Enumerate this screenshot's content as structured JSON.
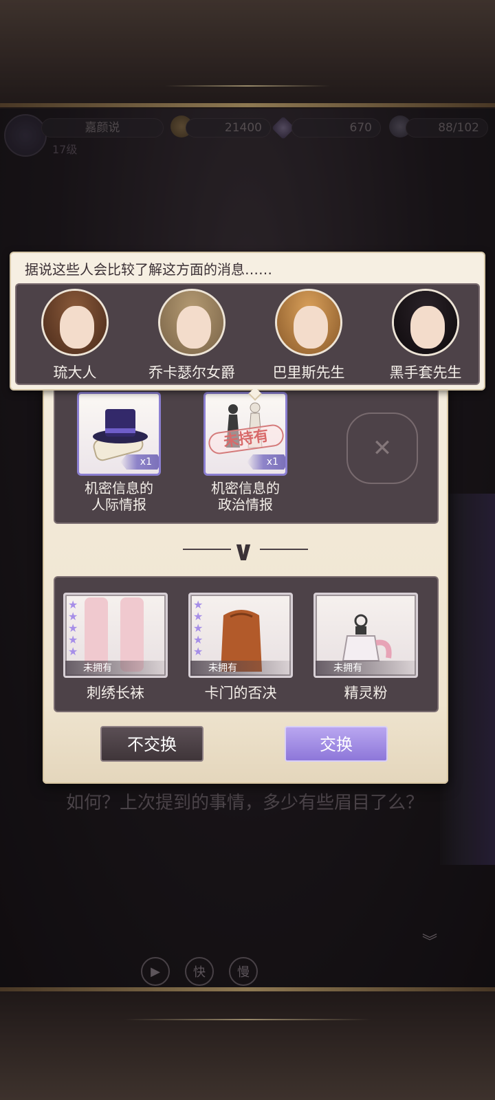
{
  "status": {
    "player_name": "嘉颜说",
    "level": "17级",
    "gold": "21400",
    "gems": "670",
    "energy": "88/102"
  },
  "tooltip": {
    "title": "据说这些人会比较了解这方面的消息……",
    "people": [
      {
        "name": "琉大人"
      },
      {
        "name": "乔卡瑟尔女爵"
      },
      {
        "name": "巴里斯先生"
      },
      {
        "name": "黑手套先生"
      }
    ]
  },
  "exchange": {
    "inputs": [
      {
        "label_line1": "机密信息的",
        "label_line2": "人际情报",
        "count": "x1",
        "status_stamp": ""
      },
      {
        "label_line1": "机密信息的",
        "label_line2": "政治情报",
        "count": "x1",
        "status_stamp": "未持有"
      }
    ],
    "rewards": [
      {
        "label": "刺绣长袜",
        "tag": "未拥有",
        "stars": "★★★★★"
      },
      {
        "label": "卡门的否决",
        "tag": "未拥有",
        "stars": "★★★★★"
      },
      {
        "label": "精灵粉",
        "tag": "未拥有",
        "stars": ""
      }
    ],
    "decline_label": "不交换",
    "confirm_label": "交换"
  },
  "dialogue": {
    "text": "如何？上次提到的事情，多少有些眉目了么？"
  },
  "controls": {
    "auto": "▶",
    "fast": "快",
    "slow": "慢"
  }
}
